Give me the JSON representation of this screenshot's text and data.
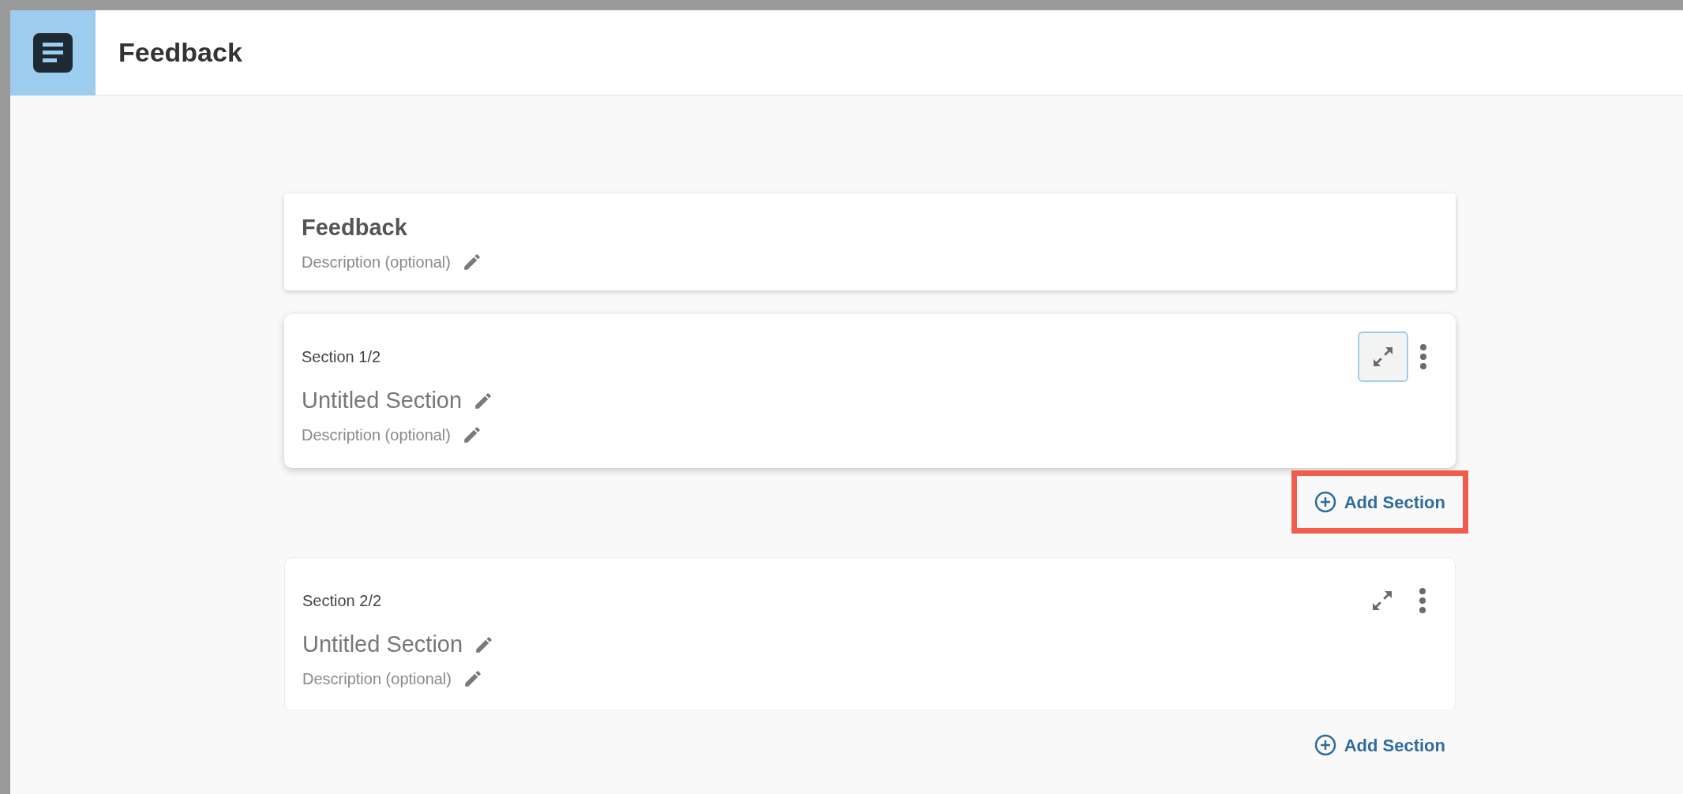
{
  "header": {
    "title": "Feedback"
  },
  "form": {
    "title": "Feedback",
    "description_placeholder": "Description (optional)"
  },
  "sections": [
    {
      "label": "Section 1/2",
      "title": "Untitled Section",
      "description_placeholder": "Description (optional)",
      "selected": true,
      "add_label": "Add Section",
      "add_highlighted": true
    },
    {
      "label": "Section 2/2",
      "title": "Untitled Section",
      "description_placeholder": "Description (optional)",
      "selected": false,
      "add_label": "Add Section",
      "add_highlighted": false
    }
  ]
}
